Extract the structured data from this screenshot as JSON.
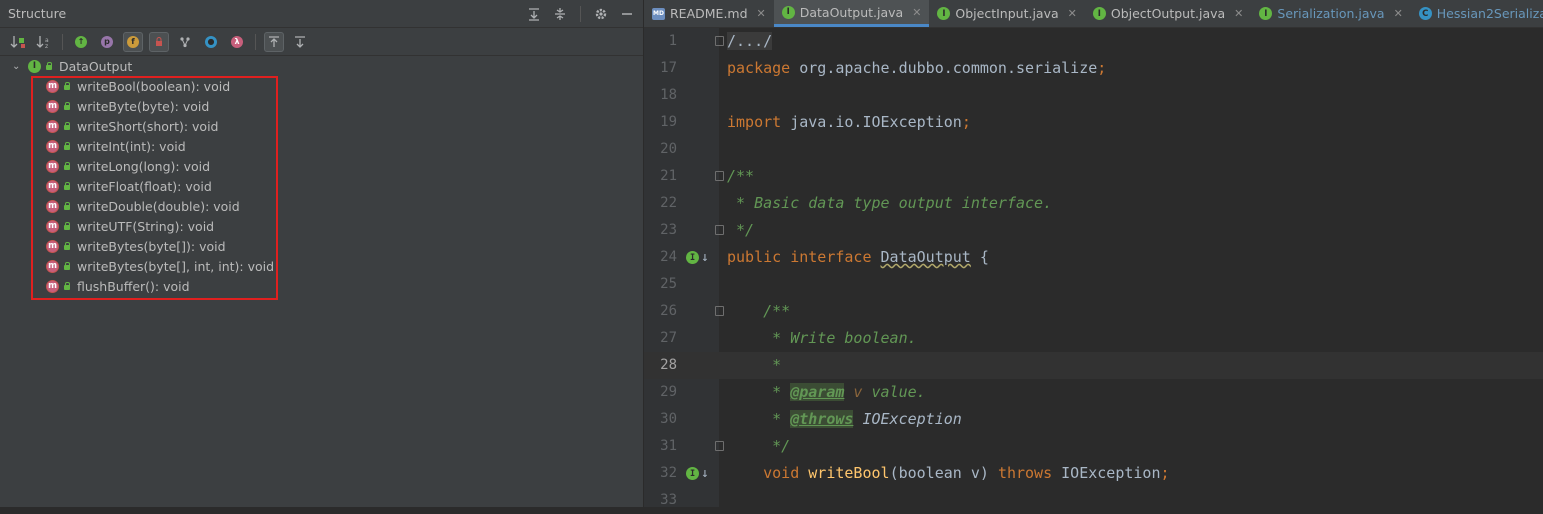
{
  "structure": {
    "title": "Structure",
    "root": {
      "name": "DataOutput"
    },
    "methods": [
      "writeBool(boolean): void",
      "writeByte(byte): void",
      "writeShort(short): void",
      "writeInt(int): void",
      "writeLong(long): void",
      "writeFloat(float): void",
      "writeDouble(double): void",
      "writeUTF(String): void",
      "writeBytes(byte[]): void",
      "writeBytes(byte[], int, int): void",
      "flushBuffer(): void"
    ]
  },
  "tabs": [
    {
      "label": "README.md",
      "icon": "markdown-file-icon",
      "active": false
    },
    {
      "label": "DataOutput.java",
      "icon": "interface-icon",
      "active": true
    },
    {
      "label": "ObjectInput.java",
      "icon": "interface-icon",
      "active": false
    },
    {
      "label": "ObjectOutput.java",
      "icon": "interface-icon",
      "active": false
    },
    {
      "label": "Serialization.java",
      "icon": "interface-icon",
      "active": false
    },
    {
      "label": "Hessian2Serialization.java",
      "icon": "class-icon",
      "active": false
    }
  ],
  "editor": {
    "current_line": "28",
    "lines": [
      {
        "n": "1",
        "t1": "/.../"
      },
      {
        "n": "17",
        "t1": "package",
        "t2": " org.apache.dubbo.common.serialize",
        "t3": ";"
      },
      {
        "n": "18"
      },
      {
        "n": "19",
        "t1": "import",
        "t2": " java.io.IOException",
        "t3": ";"
      },
      {
        "n": "20"
      },
      {
        "n": "21",
        "t1": "/**"
      },
      {
        "n": "22",
        "t1": " * Basic data type output interface."
      },
      {
        "n": "23",
        "t1": " */"
      },
      {
        "n": "24",
        "t1": "public interface",
        "t2": " ",
        "t3": "DataOutput",
        "t4": " {"
      },
      {
        "n": "25"
      },
      {
        "n": "26",
        "t1": "    /**"
      },
      {
        "n": "27",
        "t1": "     * Write boolean."
      },
      {
        "n": "28",
        "t1": "     *"
      },
      {
        "n": "29",
        "t1": "     * ",
        "t2": "@param",
        "t3": " v",
        "t4": " value."
      },
      {
        "n": "30",
        "t1": "     * ",
        "t2": "@throws",
        "t3": " IOException"
      },
      {
        "n": "31",
        "t1": "     */"
      },
      {
        "n": "32",
        "t1": "    void ",
        "t2": "writeBool",
        "t3": "(boolean v) ",
        "t4": "throws",
        "t5": " IOException",
        "t6": ";"
      },
      {
        "n": "33"
      }
    ]
  }
}
